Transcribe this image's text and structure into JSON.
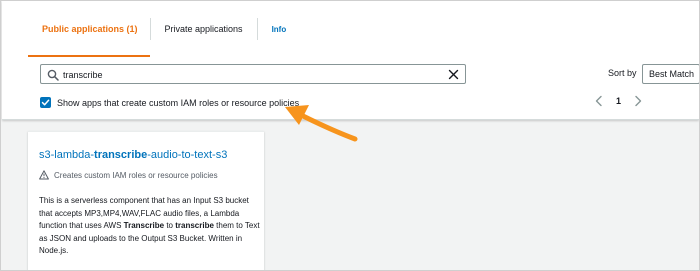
{
  "tabs": [
    {
      "label": "Public applications (1)",
      "active": true
    },
    {
      "label": "Private applications",
      "active": false
    },
    {
      "label": "Info",
      "active": false
    }
  ],
  "search": {
    "value": "transcribe",
    "icon": "search-icon",
    "clear_icon": "close-icon"
  },
  "sort": {
    "label": "Sort by",
    "value": "Best Match"
  },
  "filter": {
    "checked": true,
    "label": "Show apps that create custom IAM roles or resource policies"
  },
  "pagination": {
    "current_page": "1"
  },
  "card": {
    "title_prefix": "s3-lambda-",
    "title_highlight": "transcribe",
    "title_suffix": "-audio-to-text-s3",
    "warning": "Creates custom IAM roles or resource policies",
    "description": {
      "part1": "This is a serverless component that has an Input S3 bucket that accepts MP3,MP4,WAV,FLAC audio files, a Lambda function that uses AWS ",
      "highlight1": "Transcribe",
      "part2": " to ",
      "highlight2": "transcribe",
      "part3": " them to Text as JSON and uploads to the Output S3 Bucket. Written in Node.js."
    }
  },
  "colors": {
    "accent": "#ec7211",
    "link": "#0073bb",
    "annotation_arrow": "#f7941d"
  }
}
